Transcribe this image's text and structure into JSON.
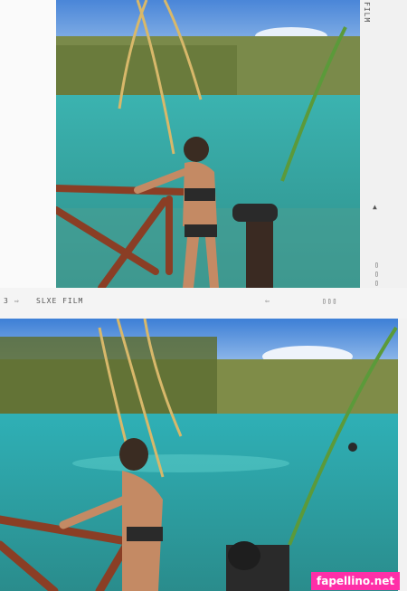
{
  "top_frame": {
    "side_label": "FILM",
    "marker_right_1": "▲",
    "marker_right_2": "▯▯▯"
  },
  "mid_bar": {
    "frame_number": "3",
    "arrow": "⇨",
    "film_label": "SLXE FILM",
    "arrow_right": "⇦",
    "boxes": "▯▯▯"
  },
  "watermark": "fapellino.net"
}
